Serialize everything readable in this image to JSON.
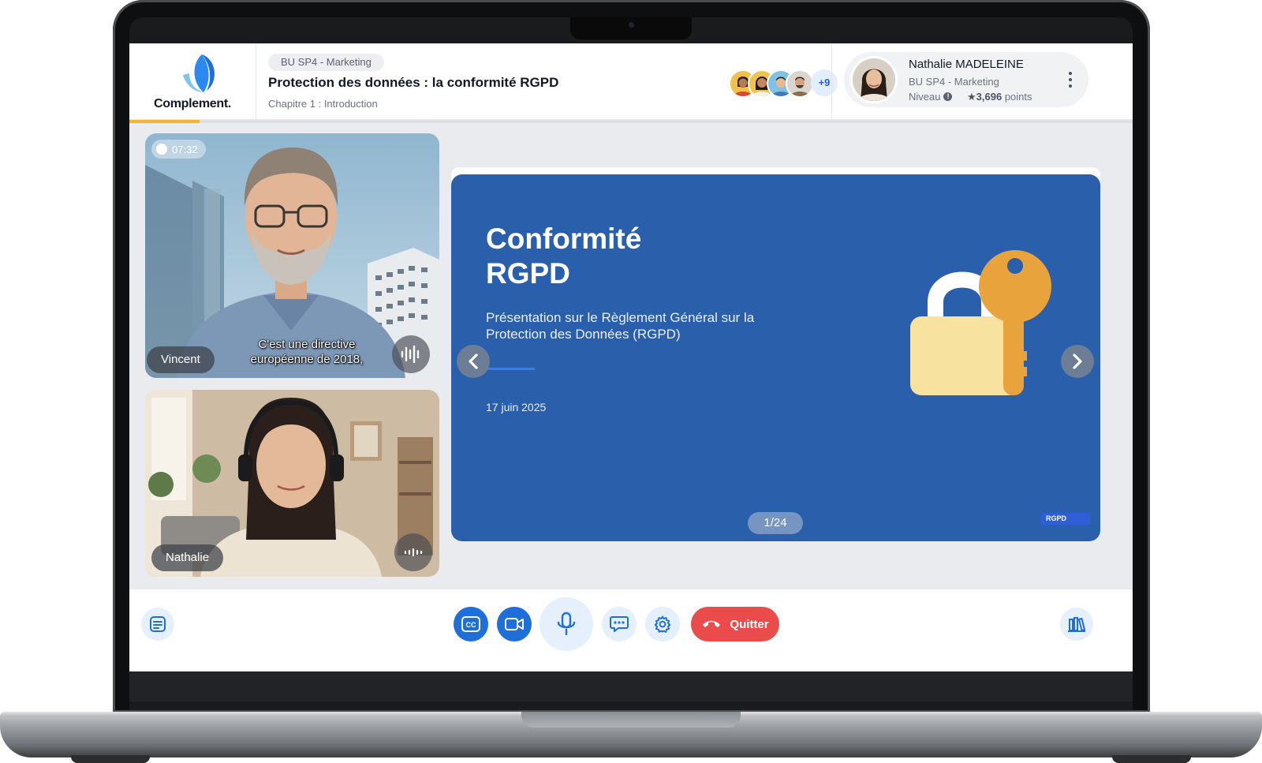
{
  "brand": {
    "name": "Complement."
  },
  "course": {
    "unit": "BU SP4 - Marketing",
    "title": "Protection des données : la conformité RGPD",
    "chapter": "Chapitre 1 : Introduction",
    "progress_fraction": 0.07
  },
  "participants": {
    "extra_count": "+9"
  },
  "profile": {
    "name": "Nathalie MADELEINE",
    "unit": "BU SP4 - Marketing",
    "level_label": "Niveau",
    "points_value": "★3,696",
    "points_unit": "points"
  },
  "videos": {
    "timer": "07:32",
    "speaker": {
      "name": "Vincent",
      "subtitle": "C'est une directive européenne de 2018,"
    },
    "self": {
      "name": "Nathalie"
    }
  },
  "slide": {
    "title_line1": "Conformité",
    "title_line2": "RGPD",
    "description": "Présentation sur le Règlement Général sur la Protection des Données (RGPD)",
    "date": "17 juin 2025",
    "tag": "RGPD",
    "page": "1/24"
  },
  "toolbar": {
    "quit_label": "Quitter",
    "icons": [
      "notes-icon",
      "captions-icon",
      "camera-icon",
      "microphone-icon",
      "chat-icon",
      "settings-icon",
      "hangup-icon",
      "library-icon"
    ]
  },
  "colors": {
    "accent": "#1f6fdb",
    "slide_bg": "#2a5fac",
    "quit": "#ea4b4b",
    "progress": "#f2b531",
    "key": "#e8a33c",
    "lock": "#f7e2a0"
  }
}
